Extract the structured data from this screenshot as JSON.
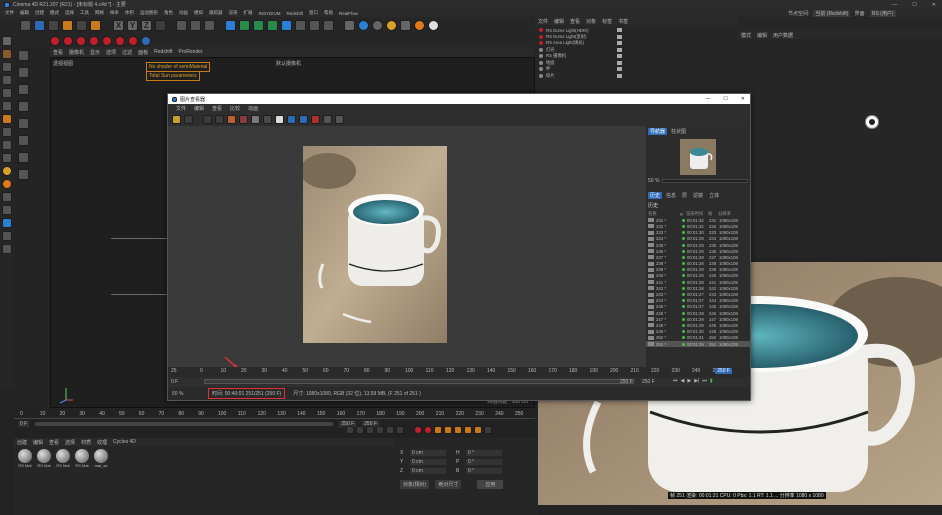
{
  "app": {
    "title": "Cinema 4D R21.207 (R21) - [未标题 4.c4d *] - 主要",
    "menus": [
      "文件",
      "编辑",
      "创建",
      "模式",
      "选择",
      "工具",
      "网格",
      "样条",
      "体积",
      "运动图形",
      "角色",
      "动画",
      "模拟",
      "跟踪器",
      "渲染",
      "扩展",
      "INSYDIUM",
      "Redshift",
      "窗口",
      "帮助",
      "RealFlow"
    ],
    "right_info": [
      "节点空间:",
      "当前 (Redshift)",
      "界面:",
      "RS (用户)"
    ]
  },
  "viewport": {
    "menus": [
      "查看",
      "摄像机",
      "显示",
      "选项",
      "过滤",
      "面板",
      "Redshift",
      "ProRender"
    ],
    "label": "透视视图",
    "camera": "默认摄像机",
    "warnings": [
      "No shader of semiMaterial",
      "Total Sun parameters"
    ],
    "grid_label": "网格间距 : 100 cm"
  },
  "object_manager": {
    "menus": [
      "文件",
      "编辑",
      "查看",
      "对象",
      "标签",
      "书签"
    ],
    "items": [
      "RS Dome Light(HDRI)",
      "RS Dome Light(反射)",
      "RS Area Light(填光)",
      "灯光",
      "RS 摄像机",
      "地面",
      "杯",
      "碎片"
    ]
  },
  "attribute_manager": {
    "menus": [
      "模式",
      "编辑",
      "用户数据"
    ]
  },
  "picture_viewer": {
    "title": "图片查看器",
    "menus": [
      "文件",
      "编辑",
      "查看",
      "比较",
      "动画"
    ],
    "tabs": [
      "导航器",
      "柱状图"
    ],
    "zoom_value": "50 %",
    "history_tabs": [
      "历史",
      "信息",
      "层",
      "滤镜",
      "立体"
    ],
    "history_header": [
      "名称",
      "R",
      "渲染时间",
      "帧",
      "分辨率"
    ],
    "history_title": "历史",
    "history_rows": [
      {
        "name": "231 *",
        "time": "00:01:32",
        "frame": "231",
        "res": "1080x108"
      },
      {
        "name": "232 *",
        "time": "00:01:32",
        "frame": "232",
        "res": "1080x108"
      },
      {
        "name": "233 *",
        "time": "00:01:30",
        "frame": "233",
        "res": "1080x108"
      },
      {
        "name": "234 *",
        "time": "00:01:29",
        "frame": "234",
        "res": "1080x108"
      },
      {
        "name": "235 *",
        "time": "00:01:29",
        "frame": "235",
        "res": "1080x108"
      },
      {
        "name": "236 *",
        "time": "00:01:29",
        "frame": "236",
        "res": "1080x108"
      },
      {
        "name": "237 *",
        "time": "00:01:28",
        "frame": "237",
        "res": "1080x108"
      },
      {
        "name": "238 *",
        "time": "00:01:28",
        "frame": "238",
        "res": "1080x108"
      },
      {
        "name": "239 *",
        "time": "00:01:29",
        "frame": "239",
        "res": "1080x108"
      },
      {
        "name": "240 *",
        "time": "00:01:28",
        "frame": "240",
        "res": "1080x108"
      },
      {
        "name": "241 *",
        "time": "00:01:28",
        "frame": "241",
        "res": "1080x108"
      },
      {
        "name": "242 *",
        "time": "00:01:28",
        "frame": "242",
        "res": "1080x108"
      },
      {
        "name": "243 *",
        "time": "00:01:27",
        "frame": "243",
        "res": "1080x108"
      },
      {
        "name": "244 *",
        "time": "00:01:27",
        "frame": "244",
        "res": "1080x108"
      },
      {
        "name": "245 *",
        "time": "00:01:27",
        "frame": "245",
        "res": "1080x108"
      },
      {
        "name": "246 *",
        "time": "00:01:28",
        "frame": "246",
        "res": "1080x108"
      },
      {
        "name": "247 *",
        "time": "00:01:29",
        "frame": "247",
        "res": "1080x108"
      },
      {
        "name": "248 *",
        "time": "00:01:29",
        "frame": "248",
        "res": "1080x108"
      },
      {
        "name": "249 *",
        "time": "00:01:30",
        "frame": "249",
        "res": "1080x108"
      },
      {
        "name": "250 *",
        "time": "00:01:31",
        "frame": "250",
        "res": "1080x108"
      },
      {
        "name": "251 *",
        "time": "00:01:29",
        "frame": "251",
        "res": "1080x108"
      }
    ],
    "ruler_ticks": [
      "0",
      "10",
      "20",
      "30",
      "40",
      "50",
      "60",
      "70",
      "80",
      "90",
      "100",
      "110",
      "120",
      "130",
      "140",
      "150",
      "160",
      "170",
      "180",
      "190",
      "200",
      "210",
      "220",
      "230",
      "240",
      "250"
    ],
    "ruler_left": "25",
    "ruler_right": "250 F",
    "frame_start": "0 F",
    "frame_end": "250 F",
    "frame_end2": "250 F",
    "status_zoom": "50 %",
    "status_time": "时间: 00:40:01 251/251 (250 F)",
    "status_info": "尺寸: 1080x1080, RGB (32 位), 13.59 MB,  (F 251 of 251 )"
  },
  "timeline": {
    "ticks": [
      "0",
      "10",
      "20",
      "30",
      "40",
      "50",
      "60",
      "70",
      "80",
      "90",
      "100",
      "110",
      "120",
      "130",
      "140",
      "150",
      "160",
      "170",
      "180",
      "190",
      "200",
      "210",
      "220",
      "230",
      "240",
      "250"
    ],
    "start": "0 F",
    "end": "250 F",
    "end2": "250 F"
  },
  "material_manager": {
    "menus": [
      "创建",
      "编辑",
      "查看",
      "选择",
      "材质",
      "纹理",
      "Cycles 4D"
    ],
    "materials": [
      "RS Mat",
      "RS Mat",
      "RS Mat",
      "RS Mat",
      "mat_se"
    ]
  },
  "coordinates": {
    "labels": [
      "X",
      "Y",
      "Z"
    ],
    "values": [
      "0 cm",
      "0 cm",
      "0 cm"
    ],
    "labels2": [
      "H",
      "P",
      "B"
    ],
    "values2": [
      "0 °",
      "0 °",
      "0 °"
    ],
    "dropdown1": "对象(相对)",
    "dropdown2": "绝对尺寸",
    "apply": "应用"
  },
  "render_view": {
    "status": "帧 251  渲染: 00:01:31  CPU: 0  Pbs: 1.1  RT: 1.1 ... 分辨率 1080 x 1080"
  }
}
